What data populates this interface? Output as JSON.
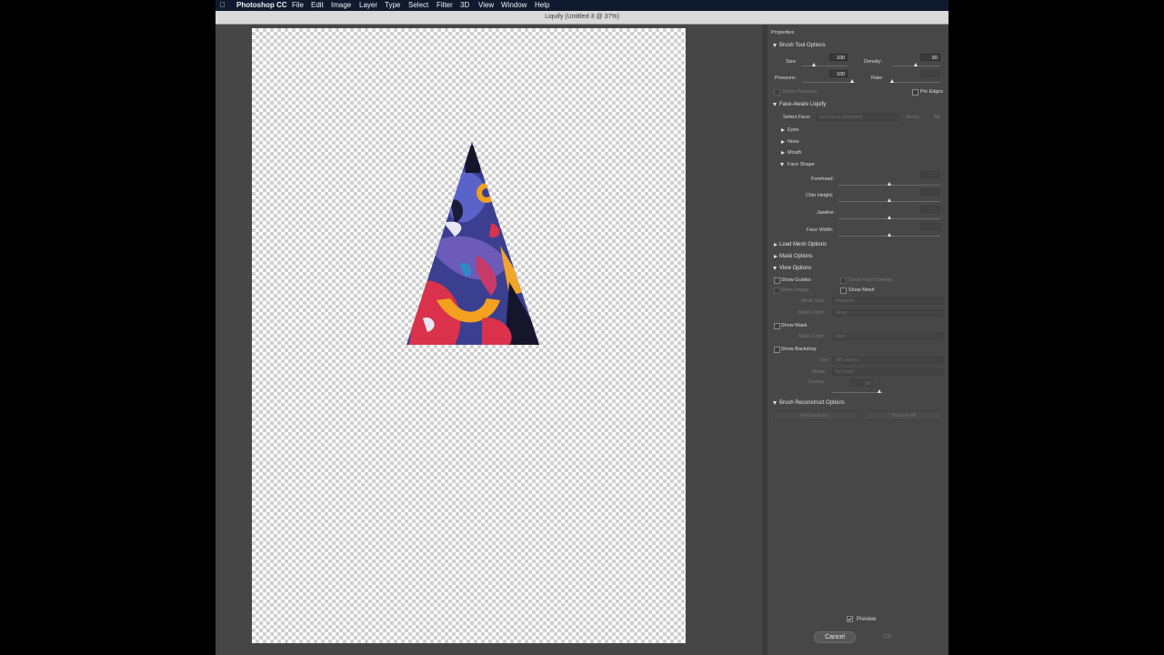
{
  "menubar": {
    "app_name": "Photoshop CC",
    "items": [
      "File",
      "Edit",
      "Image",
      "Layer",
      "Type",
      "Select",
      "Filter",
      "3D",
      "View",
      "Window",
      "Help"
    ]
  },
  "window": {
    "title": "Liquify (Untitled-3 @ 37%)"
  },
  "panel": {
    "title": "Properties",
    "brush": {
      "header": "Brush Tool Options",
      "size_label": "Size:",
      "size_value": "100",
      "density_label": "Density:",
      "density_value": "50",
      "pressure_label": "Pressure:",
      "pressure_value": "100",
      "rate_label": "Rate:",
      "stylus_label": "Stylus Pressure",
      "pin_edges_label": "Pin Edges"
    },
    "face": {
      "header": "Face-Aware Liquify",
      "select_face_label": "Select Face:",
      "select_face_value": "No Faces Detected",
      "reset_label": "Reset",
      "all_label": "All",
      "eyes": "Eyes",
      "nose": "Nose",
      "mouth": "Mouth",
      "face_shape": "Face Shape",
      "forehead": "Forehead:",
      "chin_height": "Chin Height:",
      "jawline": "Jawline:",
      "face_width": "Face Width:"
    },
    "load_mesh": "Load Mesh Options",
    "mask_options": "Mask Options",
    "view": {
      "header": "View Options",
      "show_guides": "Show Guides",
      "show_face_overlay": "Show Face Overlay",
      "show_image": "Show Image",
      "show_mesh": "Show Mesh",
      "mesh_size_label": "Mesh Size:",
      "mesh_size_value": "Medium",
      "mesh_color_label": "Mesh Color:",
      "mesh_color_value": "Gray",
      "show_mask": "Show Mask",
      "mask_color_label": "Mask Color:",
      "mask_color_value": "Red",
      "show_backdrop": "Show Backdrop",
      "use_label": "Use:",
      "use_value": "All Layers",
      "mode_label": "Mode:",
      "mode_value": "In Front",
      "opacity_label": "Opacity:",
      "opacity_value": "50"
    },
    "reconstruct": {
      "header": "Brush Reconstruct Options",
      "reconstruct_label": "Reconstruct...",
      "restore_all_label": "Restore All"
    },
    "preview_label": "Preview",
    "cancel_label": "Cancel",
    "ok_label": "OK"
  }
}
